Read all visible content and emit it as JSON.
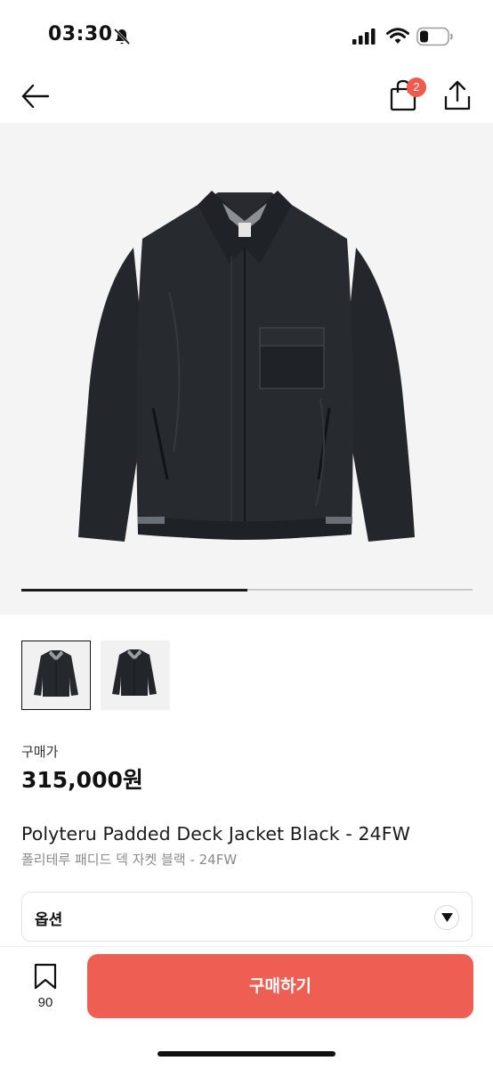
{
  "status_bar": {
    "time": "03:30"
  },
  "nav": {
    "cart_count": "2"
  },
  "gallery": {
    "progress": 0.5,
    "thumbnails": 2,
    "selected_index": 0
  },
  "product": {
    "price_label": "구매가",
    "price": "315,000원",
    "title_en": "Polyteru Padded Deck Jacket Black - 24FW",
    "title_ko": "폴리테루 패디드 덱 자켓 블랙 - 24FW"
  },
  "option": {
    "label": "옵션"
  },
  "bottom_bar": {
    "bookmark_count": "90",
    "buy_label": "구매하기"
  },
  "colors": {
    "accent": "#ef5e52",
    "badge": "#ef5a4d"
  }
}
